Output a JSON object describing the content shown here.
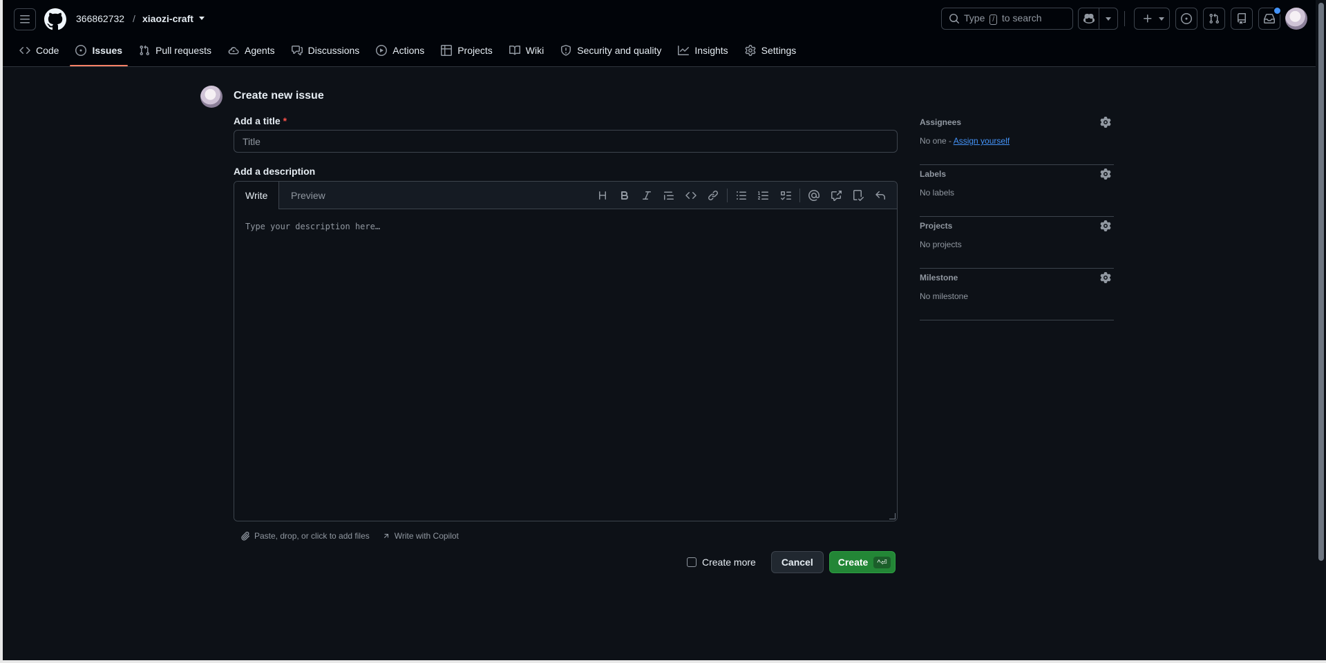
{
  "header": {
    "owner": "366862732",
    "separator": "/",
    "repo": "xiaozi-craft",
    "search": {
      "prefix": "Type",
      "key": "/",
      "suffix": "to search"
    }
  },
  "nav": {
    "tabs": [
      {
        "label": "Code",
        "icon": "code-icon"
      },
      {
        "label": "Issues",
        "icon": "issue-opened-icon",
        "active": true
      },
      {
        "label": "Pull requests",
        "icon": "git-pull-request-icon"
      },
      {
        "label": "Agents",
        "icon": "agents-cloud-icon"
      },
      {
        "label": "Discussions",
        "icon": "comment-discussion-icon"
      },
      {
        "label": "Actions",
        "icon": "play-icon"
      },
      {
        "label": "Projects",
        "icon": "table-icon"
      },
      {
        "label": "Wiki",
        "icon": "book-icon"
      },
      {
        "label": "Security and quality",
        "icon": "shield-icon"
      },
      {
        "label": "Insights",
        "icon": "graph-icon"
      },
      {
        "label": "Settings",
        "icon": "gear-icon"
      }
    ]
  },
  "form": {
    "page_title": "Create new issue",
    "title_label": "Add a title",
    "required_mark": "*",
    "title_placeholder": "Title",
    "description_label": "Add a description",
    "tab_write": "Write",
    "tab_preview": "Preview",
    "description_placeholder": "Type your description here…",
    "attach_text": "Paste, drop, or click to add files",
    "copilot_text": "Write with Copilot",
    "create_more": "Create more",
    "cancel": "Cancel",
    "create": "Create",
    "create_shortcut": "^⏎"
  },
  "sidebar": {
    "assignees": {
      "title": "Assignees",
      "value": "No one -",
      "link": "Assign yourself"
    },
    "labels": {
      "title": "Labels",
      "value": "No labels"
    },
    "projects": {
      "title": "Projects",
      "value": "No projects"
    },
    "milestone": {
      "title": "Milestone",
      "value": "No milestone"
    }
  },
  "colors": {
    "background": "#0d1117",
    "header_background": "#010409",
    "accent_tab": "#f78166",
    "create_button": "#238636",
    "link": "#4493f8"
  }
}
